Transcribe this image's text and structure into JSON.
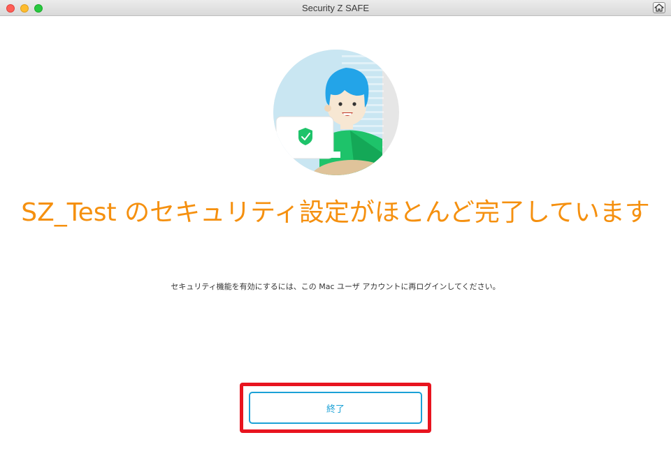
{
  "window": {
    "title": "Security Z SAFE"
  },
  "main": {
    "headline": "SZ_Test のセキュリティ設定がほとんど完了しています",
    "message": "セキュリティ機能を有効にするには、この Mac ユーザ アカウントに再ログインしてください。",
    "finish_label": "終了"
  },
  "colors": {
    "headline": "#f5900f",
    "button_accent": "#1ba1d6",
    "highlight": "#e8141f"
  },
  "icons": {
    "home": "home-icon",
    "shield": "shield-check-icon"
  }
}
